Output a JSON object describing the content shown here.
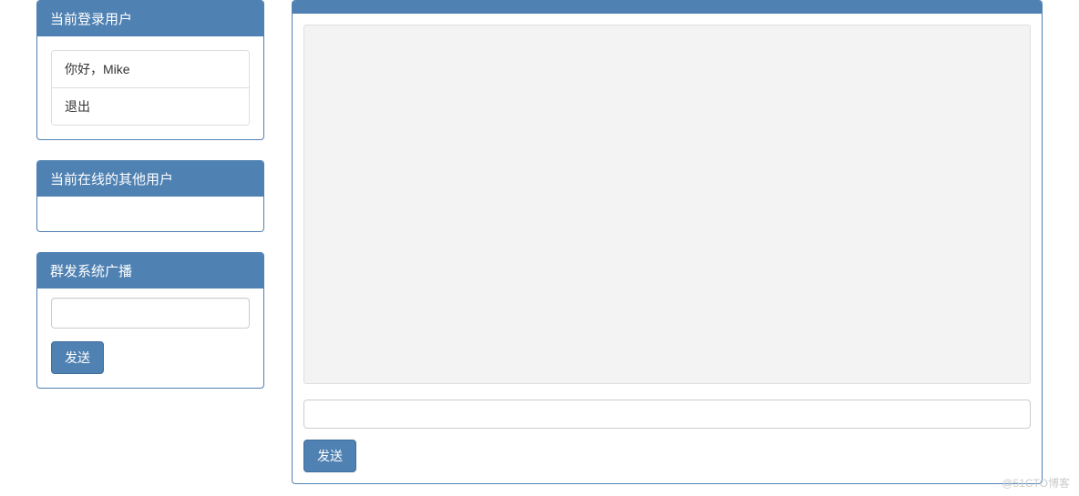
{
  "sidebar": {
    "current_user_panel": {
      "title": "当前登录用户",
      "greeting": "你好，Mike",
      "logout": "退出"
    },
    "online_users_panel": {
      "title": "当前在线的其他用户"
    },
    "broadcast_panel": {
      "title": "群发系统广播",
      "input_value": "",
      "send_label": "发送"
    }
  },
  "chat": {
    "messages": "",
    "input_value": "",
    "send_label": "发送"
  },
  "watermark": "@51CTO博客"
}
